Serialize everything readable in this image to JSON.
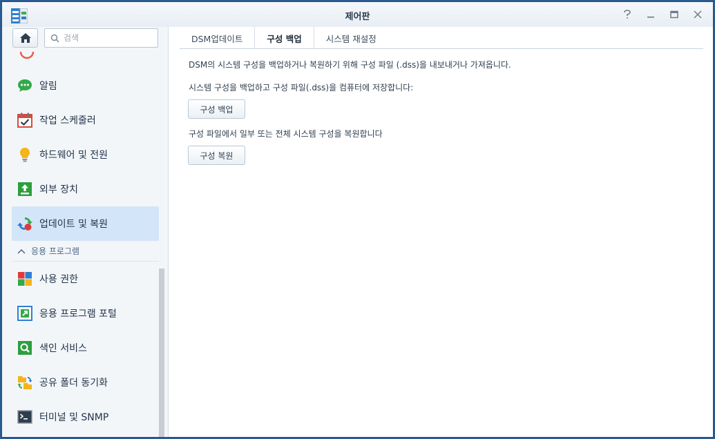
{
  "window": {
    "title": "제어판"
  },
  "sidebar": {
    "search_placeholder": "검색",
    "items": [
      {
        "label": "알림",
        "icon": "chat-bubble-icon"
      },
      {
        "label": "작업 스케줄러",
        "icon": "calendar-check-icon"
      },
      {
        "label": "하드웨어 및 전원",
        "icon": "lightbulb-icon"
      },
      {
        "label": "외부 장치",
        "icon": "upload-box-icon"
      },
      {
        "label": "업데이트 및 복원",
        "icon": "refresh-icon",
        "active": true
      }
    ],
    "section": {
      "label": "응용 프로그램"
    },
    "app_items": [
      {
        "label": "사용 권한",
        "icon": "tiles-icon"
      },
      {
        "label": "응용 프로그램 포털",
        "icon": "portal-arrow-icon"
      },
      {
        "label": "색인 서비스",
        "icon": "index-search-icon"
      },
      {
        "label": "공유 폴더 동기화",
        "icon": "folder-sync-icon"
      },
      {
        "label": "터미널 및 SNMP",
        "icon": "terminal-icon"
      }
    ]
  },
  "tabs": [
    {
      "label": "DSM업데이트",
      "active": false
    },
    {
      "label": "구성 백업",
      "active": true
    },
    {
      "label": "시스템 재설정",
      "active": false
    }
  ],
  "main": {
    "description": "DSM의 시스템 구성을 백업하거나 복원하기 위해 구성 파일 (.dss)을 내보내거나 가져옵니다.",
    "backup_text": "시스템 구성을 백업하고 구성 파일(.dss)을 컴퓨터에 저장합니다:",
    "backup_button": "구성 백업",
    "restore_text": "구성 파일에서 일부 또는 전체 시스템 구성을 복원합니다",
    "restore_button": "구성 복원"
  },
  "colors": {
    "accent": "#2c5b8e",
    "active_item": "#d3e5f8"
  }
}
